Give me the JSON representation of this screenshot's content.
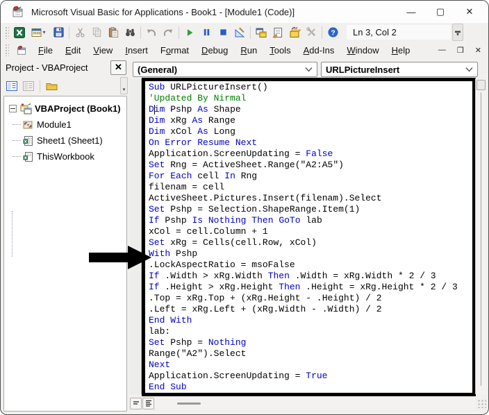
{
  "window": {
    "title": "Microsoft Visual Basic for Applications - Book1 - [Module1 (Code)]",
    "controls": {
      "minimize": "—",
      "maximize": "▢",
      "close": "✕"
    }
  },
  "toolbar": {
    "position_indicator": "Ln 3, Col 2",
    "buttons": [
      "view-microsoft-excel",
      "insert-userform",
      "save",
      "cut",
      "copy",
      "paste",
      "find",
      "undo",
      "redo",
      "run-sub",
      "break",
      "reset",
      "design-mode",
      "project-explorer",
      "properties-window",
      "object-browser",
      "toolbox",
      "help"
    ]
  },
  "menubar": {
    "items": [
      {
        "label": "File",
        "underline": 0
      },
      {
        "label": "Edit",
        "underline": 0
      },
      {
        "label": "View",
        "underline": 0
      },
      {
        "label": "Insert",
        "underline": 0
      },
      {
        "label": "Format",
        "underline": 1
      },
      {
        "label": "Debug",
        "underline": 0
      },
      {
        "label": "Run",
        "underline": 0
      },
      {
        "label": "Tools",
        "underline": 0
      },
      {
        "label": "Add-Ins",
        "underline": 0
      },
      {
        "label": "Window",
        "underline": 0
      },
      {
        "label": "Help",
        "underline": 0
      }
    ],
    "mdi_controls": {
      "minimize": "—",
      "restore": "❐",
      "close": "✕"
    }
  },
  "project_panel": {
    "title": "Project - VBAProject",
    "close_label": "✕",
    "tree": [
      {
        "label": "VBAProject (Book1)",
        "icon": "vbaproject-icon",
        "bold": true,
        "expanded": true
      },
      {
        "label": "Module1",
        "icon": "module-icon"
      },
      {
        "label": "Sheet1 (Sheet1)",
        "icon": "sheet-icon"
      },
      {
        "label": "ThisWorkbook",
        "icon": "workbook-icon"
      }
    ]
  },
  "code_window": {
    "object_dropdown": "(General)",
    "procedure_dropdown": "URLPictureInsert",
    "caret": {
      "line": 3,
      "col": 2
    },
    "syntax": {
      "keyword_color": "#0000C8",
      "comment_color": "#008000",
      "text_color": "#000000",
      "keywords": [
        "Sub",
        "End",
        "Dim",
        "As",
        "On",
        "Error",
        "Resume",
        "Next",
        "Set",
        "For",
        "Each",
        "In",
        "If",
        "Is",
        "Nothing",
        "Then",
        "GoTo",
        "With",
        "False",
        "True"
      ]
    },
    "code_lines": [
      "Sub URLPictureInsert()",
      "'Updated By Nirmal",
      "Dim Pshp As Shape",
      "Dim xRg As Range",
      "Dim xCol As Long",
      "On Error Resume Next",
      "Application.ScreenUpdating = False",
      "Set Rng = ActiveSheet.Range(\"A2:A5\")",
      "For Each cell In Rng",
      "filenam = cell",
      "ActiveSheet.Pictures.Insert(filenam).Select",
      "Set Pshp = Selection.ShapeRange.Item(1)",
      "If Pshp Is Nothing Then GoTo lab",
      "xCol = cell.Column + 1",
      "Set xRg = Cells(cell.Row, xCol)",
      "With Pshp",
      ".LockAspectRatio = msoFalse",
      "If .Width > xRg.Width Then .Width = xRg.Width * 2 / 3",
      "If .Height > xRg.Height Then .Height = xRg.Height * 2 / 3",
      ".Top = xRg.Top + (xRg.Height - .Height) / 2",
      ".Left = xRg.Left + (xRg.Width - .Width) / 2",
      "End With",
      "lab:",
      "Set Pshp = Nothing",
      "Range(\"A2\").Select",
      "Next",
      "Application.ScreenUpdating = True",
      "End Sub"
    ]
  },
  "annotation": {
    "arrow_points_to_line": 16
  }
}
